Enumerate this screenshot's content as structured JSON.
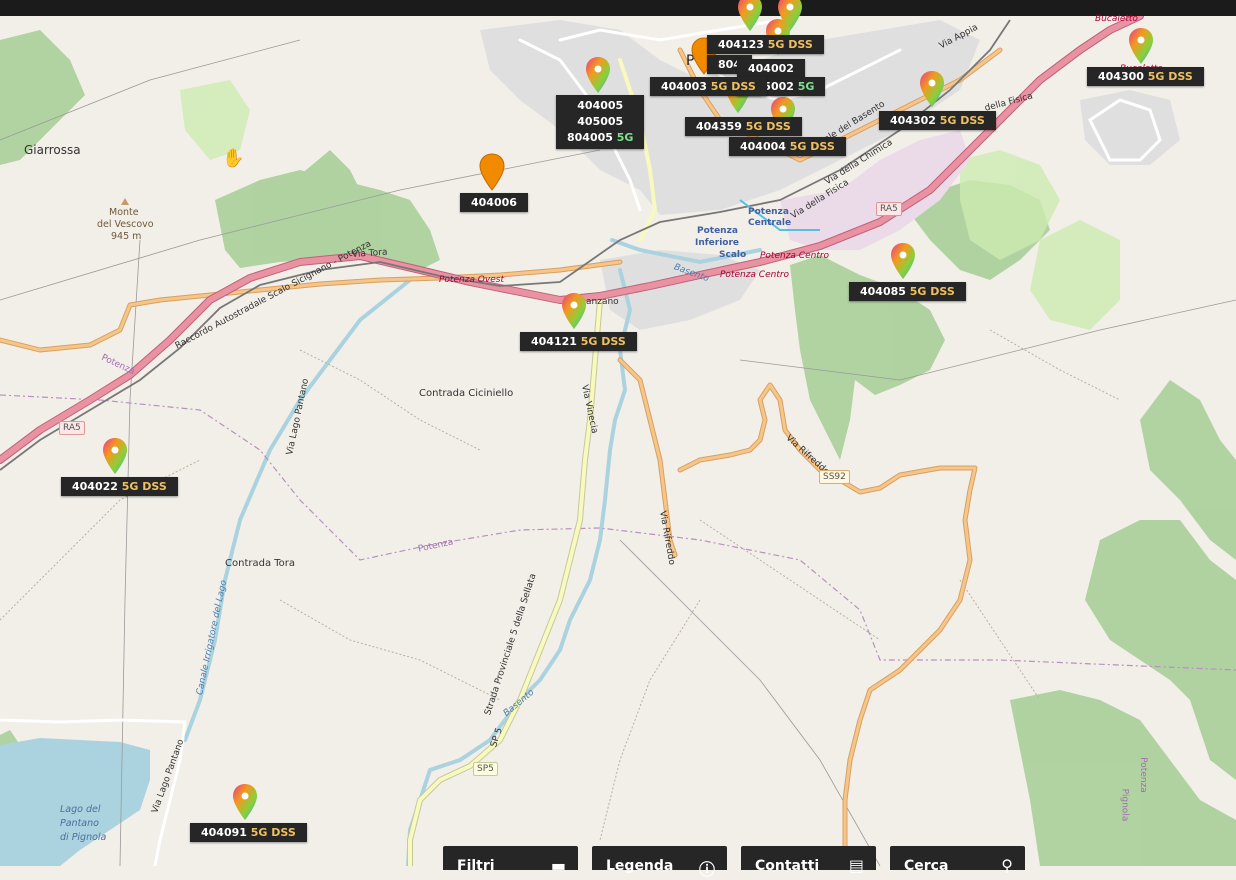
{
  "places": {
    "giarrossa": "Giarrossa",
    "monte": "Monte",
    "del_vescovo": "del Vescovo",
    "elev": "945 m",
    "ciciniello": "Contrada Ciciniello",
    "tora": "Contrada Tora",
    "lago1": "Lago del",
    "lago2": "Pantano",
    "lago3": "di Pignola",
    "bucaletto": "Bucaletto",
    "bucaletto2": "Bucaletto",
    "potenza_c1": "Potenza",
    "potenza_c2": "Centrale",
    "potenza_i1": "Potenza",
    "potenza_i2": "Inferiore",
    "potenza_i3": "Scalo",
    "potenza_centro": "Potenza Centro",
    "potenza_centro2": "Potenza Centro",
    "potenza_ovest": "Potenza Ovest",
    "potenza_bdry": "Potenza",
    "potenza_left": "Potenza",
    "pignola": "Pignola",
    "potenza_right": "Potenza",
    "p_letter": "P"
  },
  "roads": {
    "raccordo": "Raccordo Autostradale Scalo Sicignano - Potenza",
    "via_tora": "Via Tora",
    "via_lago": "Via Lago Pantano",
    "via_lago2": "Via Lago Pantano",
    "via_vinecia": "Via Vinecia",
    "via_rifreddo": "Via Rifreddo",
    "via_rifreddo2": "Via Rifreddo",
    "strada_prov": "Strada Provinciale 5 della Sellata",
    "sp5": "SP 5",
    "basento": "Basento",
    "basento2": "Basento",
    "canale": "Canale Irrigatore del Lago",
    "via_appia": "Via Appia",
    "via_chimica": "Via della Chimica",
    "via_fisica": "Via della Fisica",
    "della_fisica": "della Fisica",
    "viale_basento": "Viale del Basento",
    "anzano": "anzano",
    "ra5_a": "RA5",
    "ra5_b": "RA5",
    "ss92": "SS92",
    "sp5_shield": "SP5"
  },
  "labels": {
    "l404123": {
      "id": "404123",
      "tech": "5G DSS"
    },
    "l804": {
      "id": "804"
    },
    "l404002": {
      "id": "404002"
    },
    "l405002": {
      "id": "405002",
      "tech": "5G"
    },
    "l404003": {
      "id": "404003",
      "tech": "5G DSS"
    },
    "l404005": {
      "line1": "404005",
      "line2": "405005",
      "line3": "804005",
      "tech": "5G"
    },
    "l404359": {
      "id": "404359",
      "tech": "5G DSS"
    },
    "l404004": {
      "id": "404004",
      "tech": "5G DSS"
    },
    "l404302": {
      "id": "404302",
      "tech": "5G DSS"
    },
    "l404300": {
      "id": "404300",
      "tech": "5G DSS"
    },
    "l404006": {
      "id": "404006"
    },
    "l404085": {
      "id": "404085",
      "tech": "5G DSS"
    },
    "l404121": {
      "id": "404121",
      "tech": "5G DSS"
    },
    "l404022": {
      "id": "404022",
      "tech": "5G DSS"
    },
    "l404091": {
      "id": "404091",
      "tech": "5G DSS"
    }
  },
  "bottom": {
    "filtri": "Filtri",
    "legenda": "Legenda",
    "contatti": "Contatti",
    "cerca": "Cerca"
  },
  "icons": {
    "pin_multicolor": "map-pin-multicolor",
    "pin_orange": "map-pin-orange",
    "cursor": "hand-cursor-icon"
  },
  "colors": {
    "land": "#f2efe9",
    "forest": "#add19e",
    "motorway": "#e892a2",
    "secondary": "#f6c58a",
    "tertiary": "#f7f9be",
    "water": "#aad3df",
    "label_bg": "#262626",
    "tech_text": "#f0c060",
    "five_g": "#7ee08c",
    "pin_orange": "#f28a00"
  }
}
